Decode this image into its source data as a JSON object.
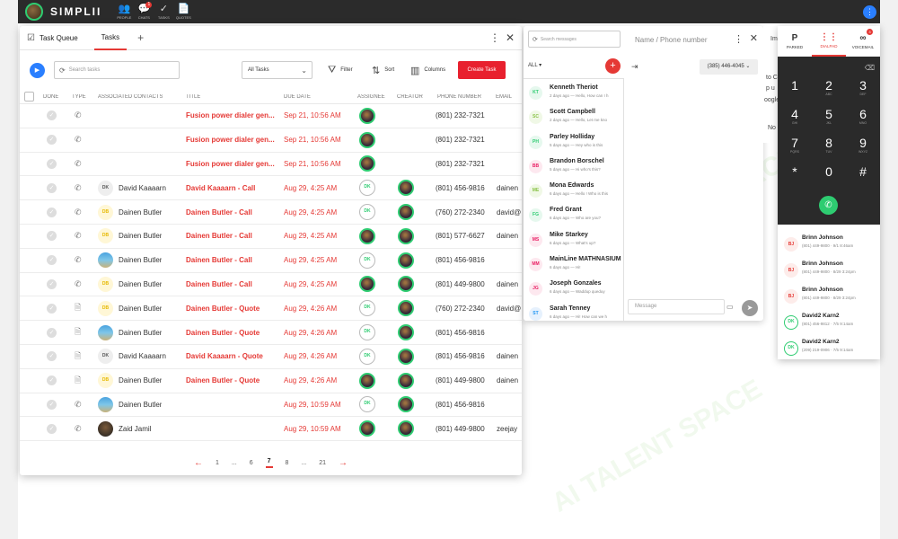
{
  "topbar": {
    "logo": "SIMPLII",
    "nav": [
      {
        "icon": "people-icon",
        "glyph": "👥",
        "label": "PEOPLE",
        "badge": ""
      },
      {
        "icon": "chats-icon",
        "glyph": "💬",
        "label": "CHATS",
        "badge": "1"
      },
      {
        "icon": "tasks-icon",
        "glyph": "✓",
        "label": "TASKS",
        "badge": ""
      },
      {
        "icon": "quotes-icon",
        "glyph": "📄",
        "label": "QUOTES",
        "badge": ""
      }
    ]
  },
  "task_panel": {
    "queue_label": "Task Queue",
    "tab_label": "Tasks",
    "search_placeholder": "Search tasks",
    "filter_value": "All Tasks",
    "filter_label": "Filter",
    "sort_label": "Sort",
    "columns_label": "Columns",
    "create_label": "Create Task",
    "headers": {
      "done": "DONE",
      "type": "TYPE",
      "contacts": "ASSOCIATED CONTACTS",
      "title": "TITLE",
      "due": "DUE DATE",
      "assignee": "ASSIGNEE",
      "creator": "CREATOR",
      "phone": "PHONE NUMBER",
      "email": "EMAIL"
    },
    "rows": [
      {
        "type": "phone",
        "contact_av": "",
        "contact_av_kind": "none",
        "contact": "",
        "title": "Fusion power dialer gen...",
        "due": "Sep 21, 10:56 AM",
        "assignee": "photo",
        "creator": "",
        "phone": "(801) 232-7321",
        "email": ""
      },
      {
        "type": "phone",
        "contact_av": "",
        "contact_av_kind": "none",
        "contact": "",
        "title": "Fusion power dialer gen...",
        "due": "Sep 21, 10:56 AM",
        "assignee": "photo",
        "creator": "",
        "phone": "(801) 232-7321",
        "email": ""
      },
      {
        "type": "phone",
        "contact_av": "",
        "contact_av_kind": "none",
        "contact": "",
        "title": "Fusion power dialer gen...",
        "due": "Sep 21, 10:56 AM",
        "assignee": "photo",
        "creator": "",
        "phone": "(801) 232-7321",
        "email": ""
      },
      {
        "type": "phone",
        "contact_av": "DK",
        "contact_av_kind": "gray",
        "contact": "David Kaaaarn",
        "title": "David Kaaaarn - Call",
        "due": "Aug 29, 4:25 AM",
        "assignee": "DK",
        "creator": "photo",
        "phone": "(801) 456-9816",
        "email": "dainen"
      },
      {
        "type": "phone",
        "contact_av": "DB",
        "contact_av_kind": "yellow",
        "contact": "Dainen Butler",
        "title": "Dainen Butler - Call",
        "due": "Aug 29, 4:25 AM",
        "assignee": "DK",
        "creator": "photo",
        "phone": "(760) 272-2340",
        "email": "david@"
      },
      {
        "type": "phone",
        "contact_av": "DB",
        "contact_av_kind": "yellow",
        "contact": "Dainen Butler",
        "title": "Dainen Butler - Call",
        "due": "Aug 29, 4:25 AM",
        "assignee": "photo",
        "creator": "photo",
        "phone": "(801) 577-6627",
        "email": "dainen"
      },
      {
        "type": "phone",
        "contact_av": "",
        "contact_av_kind": "photo-sea",
        "contact": "Dainen Butler",
        "title": "Dainen Butler - Call",
        "due": "Aug 29, 4:25 AM",
        "assignee": "DK",
        "creator": "photo",
        "phone": "(801) 456-9816",
        "email": ""
      },
      {
        "type": "phone",
        "contact_av": "DB",
        "contact_av_kind": "yellow",
        "contact": "Dainen Butler",
        "title": "Dainen Butler - Call",
        "due": "Aug 29, 4:25 AM",
        "assignee": "photo",
        "creator": "photo",
        "phone": "(801) 449-9800",
        "email": "dainen"
      },
      {
        "type": "doc",
        "contact_av": "DB",
        "contact_av_kind": "yellow",
        "contact": "Dainen Butler",
        "title": "Dainen Butler - Quote",
        "due": "Aug 29, 4:26 AM",
        "assignee": "DK",
        "creator": "photo",
        "phone": "(760) 272-2340",
        "email": "david@"
      },
      {
        "type": "doc",
        "contact_av": "",
        "contact_av_kind": "photo-sea",
        "contact": "Dainen Butler",
        "title": "Dainen Butler - Quote",
        "due": "Aug 29, 4:26 AM",
        "assignee": "DK",
        "creator": "photo",
        "phone": "(801) 456-9816",
        "email": ""
      },
      {
        "type": "doc",
        "contact_av": "DK",
        "contact_av_kind": "gray",
        "contact": "David Kaaaarn",
        "title": "David Kaaaarn - Quote",
        "due": "Aug 29, 4:26 AM",
        "assignee": "DK",
        "creator": "photo",
        "phone": "(801) 456-9816",
        "email": "dainen"
      },
      {
        "type": "doc",
        "contact_av": "DB",
        "contact_av_kind": "yellow",
        "contact": "Dainen Butler",
        "title": "Dainen Butler - Quote",
        "due": "Aug 29, 4:26 AM",
        "assignee": "photo",
        "creator": "photo",
        "phone": "(801) 449-9800",
        "email": "dainen"
      },
      {
        "type": "phone",
        "contact_av": "",
        "contact_av_kind": "photo-sea",
        "contact": "Dainen Butler",
        "title": "",
        "due": "Aug 29, 10:59 AM",
        "assignee": "DK",
        "creator": "photo",
        "phone": "(801) 456-9816",
        "email": ""
      },
      {
        "type": "phone",
        "contact_av": "",
        "contact_av_kind": "photo-dark",
        "contact": "Zaid Jamil",
        "title": "",
        "due": "Aug 29, 10:59 AM",
        "assignee": "photo",
        "creator": "photo",
        "phone": "(801) 449-9800",
        "email": "zeejay"
      }
    ],
    "pager": {
      "prev": "←",
      "pages": [
        "1",
        "...",
        "6",
        "7",
        "8",
        "...",
        "21"
      ],
      "current": "7",
      "next": "→"
    }
  },
  "messages": {
    "search_placeholder": "Search messages",
    "name_placeholder": "Name / Phone number",
    "filter": "ALL",
    "number": "(385) 446-4045",
    "compose_placeholder": "Message",
    "items": [
      {
        "initials": "KT",
        "color": "#2ecc71",
        "bg": "#e6f8ee",
        "name": "Kenneth Theriot",
        "sub": "2 days ago — Hello, How can I h"
      },
      {
        "initials": "SC",
        "color": "#8bc34a",
        "bg": "#f0f8e6",
        "name": "Scott Campbell",
        "sub": "2 days ago — Hello, Let me kno"
      },
      {
        "initials": "PH",
        "color": "#2ecc71",
        "bg": "#e6f8ee",
        "name": "Parley Holliday",
        "sub": "5 days ago — Hey who is this"
      },
      {
        "initials": "BB",
        "color": "#e91e63",
        "bg": "#fde8ef",
        "name": "Brandon Borschel",
        "sub": "5 days ago — Hi who's this?"
      },
      {
        "initials": "ME",
        "color": "#8bc34a",
        "bg": "#f0f8e6",
        "name": "Mona Edwards",
        "sub": "6 days ago — Hello ! Who is this"
      },
      {
        "initials": "FG",
        "color": "#2ecc71",
        "bg": "#e6f8ee",
        "name": "Fred Grant",
        "sub": "6 days ago — Who are you?"
      },
      {
        "initials": "MS",
        "color": "#e91e63",
        "bg": "#fde8ef",
        "name": "Mike Starkey",
        "sub": "6 days ago — What's up?"
      },
      {
        "initials": "MM",
        "color": "#e91e63",
        "bg": "#fde8ef",
        "name": "MainLine MATHNASIUM",
        "sub": "6 days ago — Hi!"
      },
      {
        "initials": "JG",
        "color": "#e91e63",
        "bg": "#fde8ef",
        "name": "Joseph Gonzales",
        "sub": "6 days ago — Waddup queduy"
      },
      {
        "initials": "ST",
        "color": "#2196f3",
        "bg": "#e6f1fd",
        "name": "Sarah Tenney",
        "sub": "6 days ago — Hi! How can we h"
      }
    ]
  },
  "bg_panel": {
    "line1": "Im",
    "line2": "to C",
    "line3": "p u",
    "line4": "oogle",
    "line5": "No"
  },
  "dialer": {
    "tabs": [
      {
        "glyph": "P",
        "label": "PARKED",
        "active": false,
        "badge": ""
      },
      {
        "glyph": "⋮⋮",
        "label": "DIALPAD",
        "active": true,
        "badge": ""
      },
      {
        "glyph": "∞",
        "label": "VOICEMAIL",
        "active": false,
        "badge": "3"
      }
    ],
    "keys": [
      {
        "d": "1",
        "l": ""
      },
      {
        "d": "2",
        "l": "ABC"
      },
      {
        "d": "3",
        "l": "DEF"
      },
      {
        "d": "4",
        "l": "GHI"
      },
      {
        "d": "5",
        "l": "JKL"
      },
      {
        "d": "6",
        "l": "MNO"
      },
      {
        "d": "7",
        "l": "PQRS"
      },
      {
        "d": "8",
        "l": "TUV"
      },
      {
        "d": "9",
        "l": "WXYZ"
      },
      {
        "d": "*",
        "l": ""
      },
      {
        "d": "0",
        "l": ""
      },
      {
        "d": "#",
        "l": ""
      }
    ],
    "recent": [
      {
        "initials": "BJ",
        "kind": "red",
        "name": "Brinn Johnson",
        "sub": "(801) 449-9800 · 9/1 8:46am"
      },
      {
        "initials": "BJ",
        "kind": "red",
        "name": "Brinn Johnson",
        "sub": "(801) 449-9800 · 8/29 3:24pm"
      },
      {
        "initials": "BJ",
        "kind": "red",
        "name": "Brinn Johnson",
        "sub": "(801) 449-9800 · 8/29 3:24pm"
      },
      {
        "initials": "DK",
        "kind": "dk",
        "name": "David2 Karn2",
        "sub": "(801) 456-9812 · 7/5 9:14am"
      },
      {
        "initials": "DK",
        "kind": "dk",
        "name": "David2 Karn2",
        "sub": "(209) 219-0906 · 7/5 9:14am"
      }
    ]
  },
  "watermark": "AI TALENT SPACE",
  "colors": {
    "accent": "#e53935",
    "primary": "#2a7fff",
    "success": "#2ecc71"
  }
}
